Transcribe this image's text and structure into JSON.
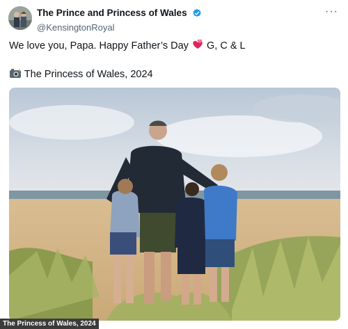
{
  "tweet": {
    "display_name": "The Prince and Princess of Wales",
    "handle": "@KensingtonRoyal",
    "verified_icon": "verified-badge-icon",
    "more_icon": "more-options-icon",
    "text_part1": "We love you, Papa. Happy Father’s Day",
    "text_part1_suffix": " G, C & L",
    "heart_icon": "two-hearts-icon",
    "camera_icon": "camera-flash-icon",
    "photo_credit": "The Princess of Wales, 2024"
  },
  "photo": {
    "description_icon": "family-beach-photo",
    "credit_overlay": "The Princess of Wales, 2024"
  },
  "colors": {
    "verified_blue": "#1d9bf0",
    "handle_gray": "#536471",
    "heart_pink": "#e0245e"
  }
}
